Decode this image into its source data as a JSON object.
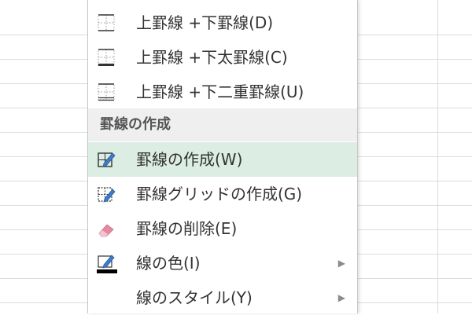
{
  "menu": {
    "items_top": [
      {
        "label": "上罫線 +下罫線(D)",
        "icon": "top-bottom-border-icon"
      },
      {
        "label": "上罫線 +下太罫線(C)",
        "icon": "top-thick-bottom-border-icon"
      },
      {
        "label": "上罫線 +下二重罫線(U)",
        "icon": "top-double-bottom-border-icon"
      }
    ],
    "section_title": "罫線の作成",
    "items_draw": [
      {
        "label": "罫線の作成(W)",
        "icon": "draw-border-icon",
        "active": true
      },
      {
        "label": "罫線グリッドの作成(G)",
        "icon": "draw-border-grid-icon"
      },
      {
        "label": "罫線の削除(E)",
        "icon": "eraser-icon"
      },
      {
        "label": "線の色(I)",
        "icon": "line-color-icon",
        "submenu": true
      },
      {
        "label": "線のスタイル(Y)",
        "icon": "",
        "submenu": true
      }
    ],
    "submenu_arrow": "▶"
  },
  "colors": {
    "active_background": "#dcede3",
    "section_background": "#efefef",
    "pencil_blue": "#3e7cc7",
    "eraser_pink": "#e58aa0",
    "line_color_swatch": "#000000"
  }
}
